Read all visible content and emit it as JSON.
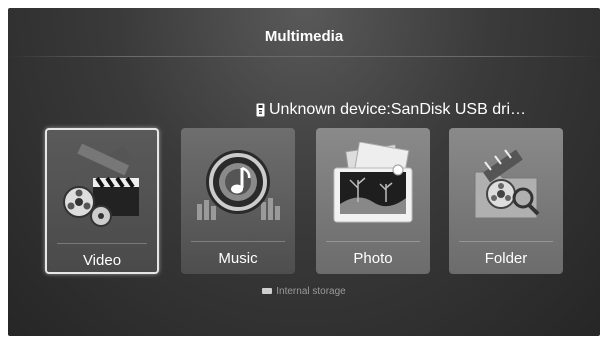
{
  "header": {
    "title": "Multimedia"
  },
  "device": {
    "text": "Unknown device:SanDisk USB dri…",
    "icon": "usb-icon"
  },
  "tiles": [
    {
      "label": "Video",
      "icon": "film-reel-clapper-icon",
      "selected": true
    },
    {
      "label": "Music",
      "icon": "music-note-speaker-icon",
      "selected": false
    },
    {
      "label": "Photo",
      "icon": "photo-frame-icon",
      "selected": false
    },
    {
      "label": "Folder",
      "icon": "folder-film-icon",
      "selected": false
    }
  ],
  "storage": {
    "text": "Internal storage",
    "icon": "hard-drive-icon"
  }
}
